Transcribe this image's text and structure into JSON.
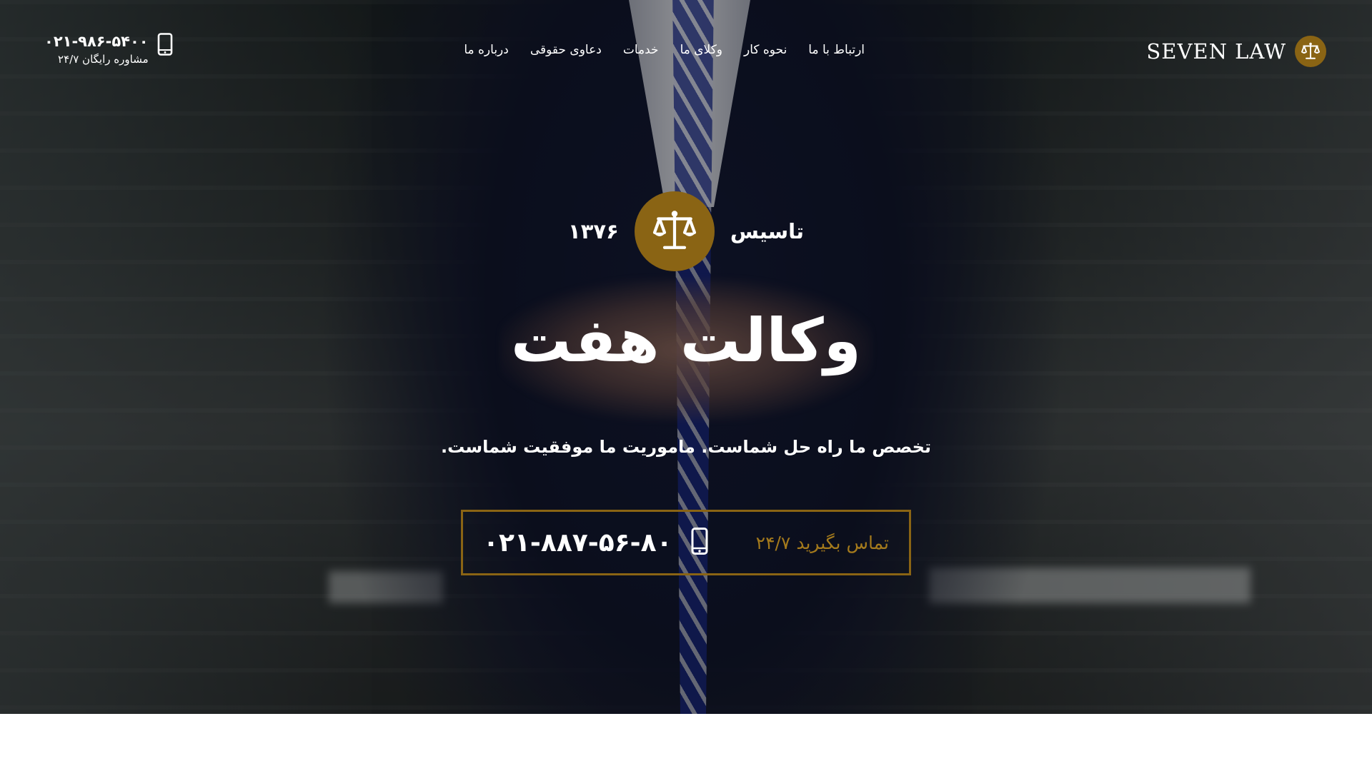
{
  "brand": {
    "name": "SEVEN LAW",
    "accent_color": "#8a6414",
    "icon": "scales-icon"
  },
  "nav": {
    "items": [
      {
        "label": "درباره ما"
      },
      {
        "label": "دعاوی حقوقی"
      },
      {
        "label": "خدمات"
      },
      {
        "label": "وکلای ما"
      },
      {
        "label": "نحوه کار"
      },
      {
        "label": "ارتباط با ما"
      }
    ]
  },
  "header_contact": {
    "phone": "۰۲۱-۹۸۶-۵۴۰۰",
    "subtitle": "مشاوره رایگان ۲۴/۷",
    "icon": "mobile-phone-icon"
  },
  "hero": {
    "established_label": "تاسیس",
    "established_year": "۱۳۷۶",
    "title": "وکالت هفت",
    "tagline": "تخصص ما راه حل شماست. ماموریت ما موفقیت شماست.",
    "cta_label": "تماس بگیرید ۲۴/۷",
    "cta_phone": "۰۲۱-۸۸۷-۵۶-۸۰",
    "cta_icon": "mobile-phone-icon"
  }
}
